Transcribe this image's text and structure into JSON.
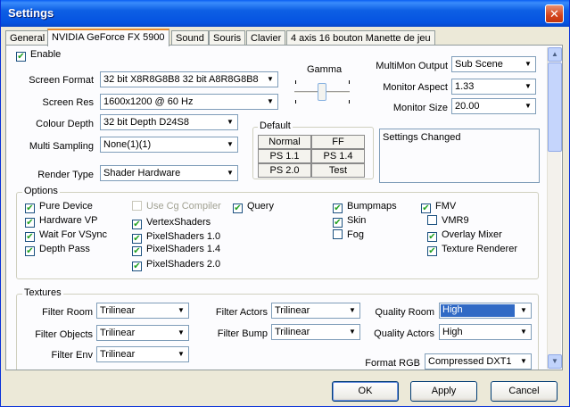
{
  "window": {
    "title": "Settings",
    "close_label": "✕"
  },
  "tabs": [
    {
      "label": "General"
    },
    {
      "label": "NVIDIA GeForce FX 5900"
    },
    {
      "label": "Sound"
    },
    {
      "label": "Souris"
    },
    {
      "label": "Clavier"
    },
    {
      "label": "4 axis 16 bouton Manette de jeu"
    }
  ],
  "panel": {
    "enable": {
      "label": "Enable",
      "checked": true
    },
    "screen_format": {
      "label": "Screen Format",
      "value": "32 bit X8R8G8B8 32 bit A8R8G8B8"
    },
    "screen_res": {
      "label": "Screen Res",
      "value": "1600x1200 @ 60 Hz"
    },
    "colour_depth": {
      "label": "Colour Depth",
      "value": "32 bit Depth D24S8"
    },
    "multi_sampling": {
      "label": "Multi Sampling",
      "value": "None(1)(1)"
    },
    "render_type": {
      "label": "Render Type",
      "value": "Shader Hardware"
    },
    "gamma": {
      "label": "Gamma"
    },
    "default_group": {
      "title": "Default",
      "buttons": [
        "Normal",
        "FF",
        "PS 1.1",
        "PS 1.4",
        "PS 2.0",
        "Test"
      ]
    },
    "multimon_output": {
      "label": "MultiMon Output",
      "value": "Sub Scene"
    },
    "monitor_aspect": {
      "label": "Monitor Aspect",
      "value": "1.33"
    },
    "monitor_size": {
      "label": "Monitor Size",
      "value": "20.00"
    },
    "status_text": "Settings Changed",
    "options": {
      "title": "Options",
      "items": [
        {
          "label": "Pure Device",
          "checked": true,
          "enabled": true
        },
        {
          "label": "Hardware VP",
          "checked": true,
          "enabled": true
        },
        {
          "label": "Wait For VSync",
          "checked": true,
          "enabled": true
        },
        {
          "label": "Depth Pass",
          "checked": true,
          "enabled": true
        },
        {
          "label": "Use Cg Compiler",
          "checked": false,
          "enabled": false
        },
        {
          "label": "VertexShaders",
          "checked": true,
          "enabled": true
        },
        {
          "label": "PixelShaders 1.0",
          "checked": true,
          "enabled": true
        },
        {
          "label": "PixelShaders 1.4",
          "checked": true,
          "enabled": true
        },
        {
          "label": "PixelShaders 2.0",
          "checked": true,
          "enabled": true
        },
        {
          "label": "Query",
          "checked": true,
          "enabled": true
        },
        {
          "label": "Bumpmaps",
          "checked": true,
          "enabled": true
        },
        {
          "label": "Skin",
          "checked": true,
          "enabled": true
        },
        {
          "label": "Fog",
          "checked": false,
          "enabled": true
        },
        {
          "label": "FMV",
          "checked": true,
          "enabled": true
        },
        {
          "label": "VMR9",
          "checked": false,
          "enabled": true
        },
        {
          "label": "Overlay Mixer",
          "checked": true,
          "enabled": true
        },
        {
          "label": "Texture Renderer",
          "checked": true,
          "enabled": true
        }
      ]
    },
    "textures": {
      "title": "Textures",
      "filter_room": {
        "label": "Filter Room",
        "value": "Trilinear"
      },
      "filter_objects": {
        "label": "Filter Objects",
        "value": "Trilinear"
      },
      "filter_env": {
        "label": "Filter Env",
        "value": "Trilinear"
      },
      "filter_actors": {
        "label": "Filter Actors",
        "value": "Trilinear"
      },
      "filter_bump": {
        "label": "Filter Bump",
        "value": "Trilinear"
      },
      "quality_room": {
        "label": "Quality Room",
        "value": "High"
      },
      "quality_actors": {
        "label": "Quality Actors",
        "value": "High"
      },
      "format_rgb": {
        "label": "Format RGB",
        "value": "Compressed DXT1"
      }
    }
  },
  "footer": {
    "ok_label": "OK",
    "apply_label": "Apply",
    "cancel_label": "Cancel"
  },
  "colors": {
    "titlebar": "#0553e1",
    "selection": "#316ac5",
    "tab_accent": "#e68b2c",
    "check": "#21a121"
  }
}
